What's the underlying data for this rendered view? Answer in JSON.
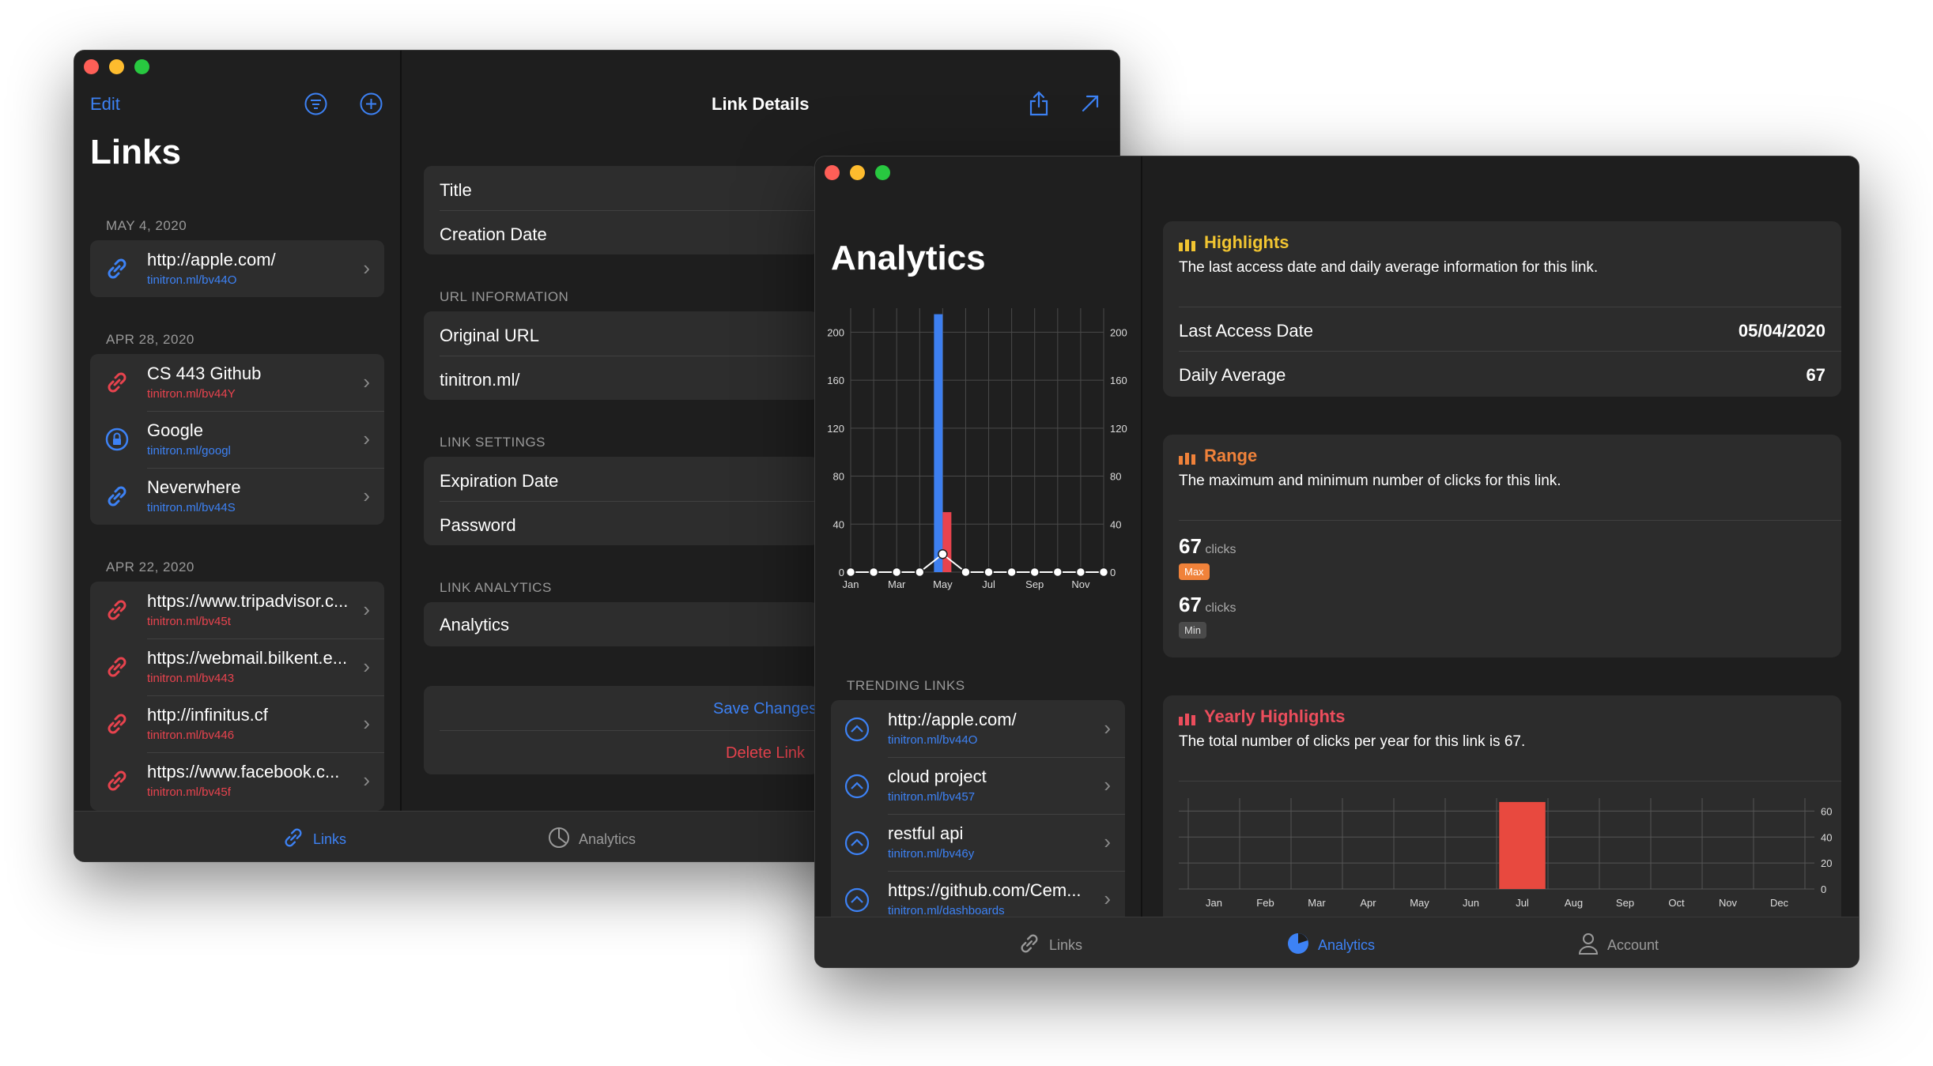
{
  "links_window": {
    "edit_label": "Edit",
    "title": "Links",
    "sections": [
      {
        "date": "MAY 4, 2020",
        "items": [
          {
            "url": "http://apple.com/",
            "short": "tinitron.ml/bv44O",
            "color": "blue",
            "icon": "link-icon"
          }
        ]
      },
      {
        "date": "APR 28, 2020",
        "items": [
          {
            "url": "CS 443 Github",
            "short": "tinitron.ml/bv44Y",
            "color": "red",
            "icon": "link-icon"
          },
          {
            "url": "Google",
            "short": "tinitron.ml/googl",
            "color": "blue",
            "icon": "lock-icon"
          },
          {
            "url": "Neverwhere",
            "short": "tinitron.ml/bv44S",
            "color": "blue",
            "icon": "link-icon"
          }
        ]
      },
      {
        "date": "APR 22, 2020",
        "items": [
          {
            "url": "https://www.tripadvisor.c...",
            "short": "tinitron.ml/bv45t",
            "color": "red",
            "icon": "link-icon"
          },
          {
            "url": "https://webmail.bilkent.e...",
            "short": "tinitron.ml/bv443",
            "color": "red",
            "icon": "link-icon"
          },
          {
            "url": "http://infinitus.cf",
            "short": "tinitron.ml/bv446",
            "color": "red",
            "icon": "link-icon"
          },
          {
            "url": "https://www.facebook.c...",
            "short": "tinitron.ml/bv45f",
            "color": "red",
            "icon": "link-icon"
          }
        ]
      }
    ],
    "detail": {
      "header": "Link Details",
      "title_label": "Title",
      "creation_label": "Creation Date",
      "url_section": "URL INFORMATION",
      "original_url_label": "Original URL",
      "short_prefix": "tinitron.ml/",
      "settings_section": "LINK SETTINGS",
      "expiration_label": "Expiration Date",
      "password_label": "Password",
      "analytics_section": "LINK ANALYTICS",
      "analytics_label": "Analytics",
      "save_label": "Save Changes",
      "delete_label": "Delete Link"
    },
    "tabs": {
      "links": "Links",
      "analytics": "Analytics"
    }
  },
  "analytics_window": {
    "title": "Analytics",
    "chart_data": [
      {
        "type": "bar",
        "categories": [
          "Jan",
          "Feb",
          "Mar",
          "Apr",
          "May",
          "Jun",
          "Jul",
          "Aug",
          "Sep",
          "Oct",
          "Nov",
          "Dec"
        ],
        "x_tick_labels": [
          "Jan",
          "Mar",
          "May",
          "Jul",
          "Sep",
          "Nov"
        ],
        "series": [
          {
            "values": [
              0,
              0,
              0,
              0,
              215,
              0,
              0,
              0,
              0,
              0,
              0,
              0
            ],
            "color": "#3d7ff0"
          },
          {
            "values": [
              0,
              0,
              0,
              0,
              50,
              0,
              0,
              0,
              0,
              0,
              0,
              0
            ],
            "color": "#e8434e"
          }
        ],
        "line_values": [
          0,
          0,
          0,
          0,
          15,
          0,
          0,
          0,
          0,
          0,
          0,
          0
        ],
        "yticks": [
          0,
          40,
          80,
          120,
          160,
          200
        ],
        "ylim": [
          0,
          220
        ],
        "grid": true
      },
      {
        "type": "bar",
        "categories": [
          "Jan",
          "Feb",
          "Mar",
          "Apr",
          "May",
          "Jun",
          "Jul",
          "Aug",
          "Sep",
          "Oct",
          "Nov",
          "Dec"
        ],
        "values": [
          0,
          0,
          0,
          0,
          0,
          0,
          67,
          0,
          0,
          0,
          0,
          0
        ],
        "yticks": [
          0,
          20,
          40,
          60
        ],
        "ylim": [
          0,
          70
        ],
        "color": "#e8493f",
        "grid": true
      }
    ],
    "trending_section": "TRENDING LINKS",
    "trending": [
      {
        "url": "http://apple.com/",
        "short": "tinitron.ml/bv44O"
      },
      {
        "url": "cloud project",
        "short": "tinitron.ml/bv457"
      },
      {
        "url": "restful api",
        "short": "tinitron.ml/bv46y"
      },
      {
        "url": "https://github.com/Cem...",
        "short": "tinitron.ml/dashboards"
      }
    ],
    "highlights": {
      "title": "Highlights",
      "desc": "The last access date and daily average information for this link.",
      "last_access_label": "Last Access Date",
      "last_access_value": "05/04/2020",
      "daily_avg_label": "Daily Average",
      "daily_avg_value": "67",
      "color": "#f2c531"
    },
    "range": {
      "title": "Range",
      "desc": "The maximum and minimum number of clicks for this link.",
      "max_value": "67",
      "min_value": "67",
      "unit": "clicks",
      "max_badge": "Max",
      "min_badge": "Min",
      "color": "#f0823a"
    },
    "yearly": {
      "title": "Yearly Highlights",
      "desc": "The total number of clicks per year for this link is 67.",
      "color": "#ec4d5c"
    },
    "tabs": {
      "links": "Links",
      "analytics": "Analytics",
      "account": "Account"
    }
  }
}
